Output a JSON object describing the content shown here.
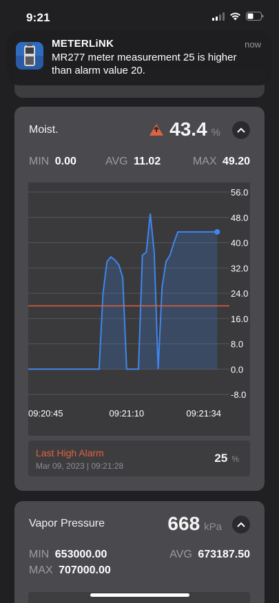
{
  "status_bar": {
    "time": "9:21"
  },
  "notification": {
    "app_name": "METERLiNK",
    "time": "now",
    "message": "MR277 meter measurement 25 is higher than alarm value 20.",
    "icon": "meter-app-icon"
  },
  "moisture": {
    "title": "Moist.",
    "value": "43.4",
    "unit": "%",
    "alert_icon": "warning-triangle-icon",
    "min_label": "MIN",
    "min_value": "0.00",
    "avg_label": "AVG",
    "avg_value": "11.02",
    "max_label": "MAX",
    "max_value": "49.20",
    "last_alarm": {
      "label": "Last High Alarm",
      "date": "Mar 09, 2023 | 09:21:28",
      "value": "25",
      "unit": "%"
    }
  },
  "vapor_pressure": {
    "title": "Vapor Pressure",
    "value": "668",
    "unit": "kPa",
    "min_label": "MIN",
    "min_value": "653000.00",
    "avg_label": "AVG",
    "avg_value": "673187.50",
    "max_label": "MAX",
    "max_value": "707000.00"
  },
  "colors": {
    "line": "#3f86ee",
    "alarm_line": "#e2623f",
    "alarm_text": "#e2623f",
    "warning": "#e2623f"
  },
  "chart_data": {
    "type": "area",
    "x_tick_labels": [
      "09:20:45",
      "09:21:10",
      "09:21:34"
    ],
    "y_tick_labels": [
      "56.0",
      "48.0",
      "40.0",
      "32.0",
      "24.0",
      "16.0",
      "8.0",
      "0.0",
      "-8.0"
    ],
    "ylim": [
      -8,
      56
    ],
    "alarm_threshold": 20,
    "series": [
      {
        "x": [
          "09:20:45",
          "09:21:03",
          "09:21:04",
          "09:21:05",
          "09:21:06",
          "09:21:07",
          "09:21:08",
          "09:21:09",
          "09:21:10",
          "09:21:11",
          "09:21:12",
          "09:21:13",
          "09:21:14",
          "09:21:15",
          "09:21:16",
          "09:21:17",
          "09:21:18",
          "09:21:19",
          "09:21:20",
          "09:21:21",
          "09:21:22",
          "09:21:23",
          "09:21:24",
          "09:21:25",
          "09:21:26",
          "09:21:27",
          "09:21:28",
          "09:21:29",
          "09:21:30",
          "09:21:31",
          "09:21:32",
          "09:21:33"
        ],
        "y": [
          0,
          0,
          24,
          34,
          35.5,
          34.5,
          33,
          29,
          0,
          0,
          0,
          0,
          36,
          37,
          49.2,
          37,
          0,
          26,
          34,
          36,
          40,
          43.4,
          43.4,
          43.4,
          43.4,
          43.4,
          43.4,
          43.4,
          43.4,
          43.4,
          43.4,
          43.4
        ]
      }
    ]
  }
}
